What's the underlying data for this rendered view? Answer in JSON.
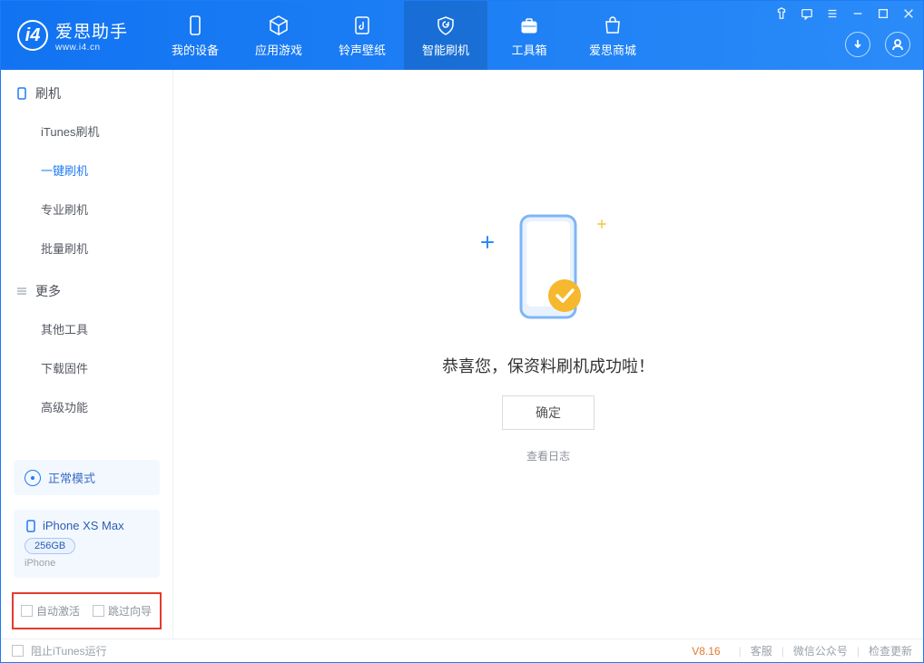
{
  "app": {
    "name": "爱思助手",
    "url": "www.i4.cn"
  },
  "nav": {
    "tabs": [
      {
        "label": "我的设备"
      },
      {
        "label": "应用游戏"
      },
      {
        "label": "铃声壁纸"
      },
      {
        "label": "智能刷机"
      },
      {
        "label": "工具箱"
      },
      {
        "label": "爱思商城"
      }
    ],
    "active_index": 3
  },
  "sidebar": {
    "section_flash_title": "刷机",
    "section_more_title": "更多",
    "flash_items": [
      {
        "label": "iTunes刷机"
      },
      {
        "label": "一键刷机"
      },
      {
        "label": "专业刷机"
      },
      {
        "label": "批量刷机"
      }
    ],
    "flash_active_index": 1,
    "more_items": [
      {
        "label": "其他工具"
      },
      {
        "label": "下载固件"
      },
      {
        "label": "高级功能"
      }
    ],
    "mode": "正常模式",
    "device": {
      "name": "iPhone XS Max",
      "capacity": "256GB",
      "type": "iPhone"
    },
    "options": {
      "auto_activate": "自动激活",
      "skip_guide": "跳过向导"
    }
  },
  "main": {
    "success_message": "恭喜您，保资料刷机成功啦！",
    "confirm_label": "确定",
    "view_log_label": "查看日志"
  },
  "footer": {
    "block_itunes": "阻止iTunes运行",
    "version": "V8.16",
    "support": "客服",
    "wechat": "微信公众号",
    "check_update": "检查更新"
  }
}
